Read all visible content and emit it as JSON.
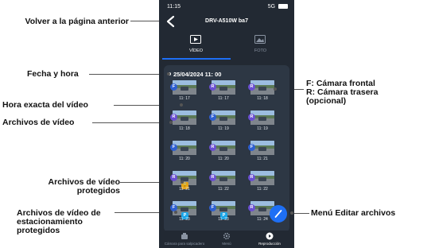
{
  "status_bar": {
    "time": "11:15",
    "signal": "5G"
  },
  "header": {
    "title": "DRV-A510W ba7"
  },
  "tabs": [
    {
      "label": "VÍDEO"
    },
    {
      "label": "FOTO"
    }
  ],
  "date_header": "25/04/2024 11: 00",
  "thumbnails": [
    {
      "cam": "F",
      "time": "11: 17",
      "flag": ""
    },
    {
      "cam": "R",
      "time": "11: 17",
      "flag": ""
    },
    {
      "cam": "R",
      "time": "11: 18",
      "flag": ""
    },
    {
      "cam": "R",
      "time": "11: 18",
      "flag": ""
    },
    {
      "cam": "F",
      "time": "11: 19",
      "flag": ""
    },
    {
      "cam": "R",
      "time": "11: 19",
      "flag": ""
    },
    {
      "cam": "F",
      "time": "11: 20",
      "flag": ""
    },
    {
      "cam": "R",
      "time": "11: 20",
      "flag": ""
    },
    {
      "cam": "F",
      "time": "11: 21",
      "flag": ""
    },
    {
      "cam": "R",
      "time": "11: 21",
      "flag": "lock"
    },
    {
      "cam": "R",
      "time": "11: 22",
      "flag": ""
    },
    {
      "cam": "R",
      "time": "11: 22",
      "flag": ""
    },
    {
      "cam": "F",
      "time": "11: 23",
      "flag": "park"
    },
    {
      "cam": "F",
      "time": "11: 23",
      "flag": "park"
    },
    {
      "cam": "R",
      "time": "11: 24",
      "flag": ""
    }
  ],
  "badges": {
    "lock_glyph": "🔒",
    "park_glyph": "P"
  },
  "bottom_nav": [
    {
      "label": "Cámara para salpicadero"
    },
    {
      "label": "Menú"
    },
    {
      "label": "Reproducción"
    }
  ],
  "callouts": {
    "back": "Volver a la página anterior",
    "date": "Fecha y hora",
    "exact_time": "Hora exacta del vídeo",
    "files": "Archivos de vídeo",
    "protected": "Archivos de vídeo protegidos",
    "parking": "Archivos de vídeo de estacionamiento protegidos",
    "camera_legend_f": "F: Cámara frontal",
    "camera_legend_r": "R: Cámara trasera (opcional)",
    "edit_menu": "Menú Editar archivos"
  },
  "colors": {
    "phone_bg": "#222933",
    "panel_bg": "#2d3744",
    "accent": "#1e6ff5",
    "badge_front": "#2f5fd0",
    "badge_rear": "#6a4fd2",
    "lock": "#e8a316",
    "park": "#1aa5e8"
  }
}
